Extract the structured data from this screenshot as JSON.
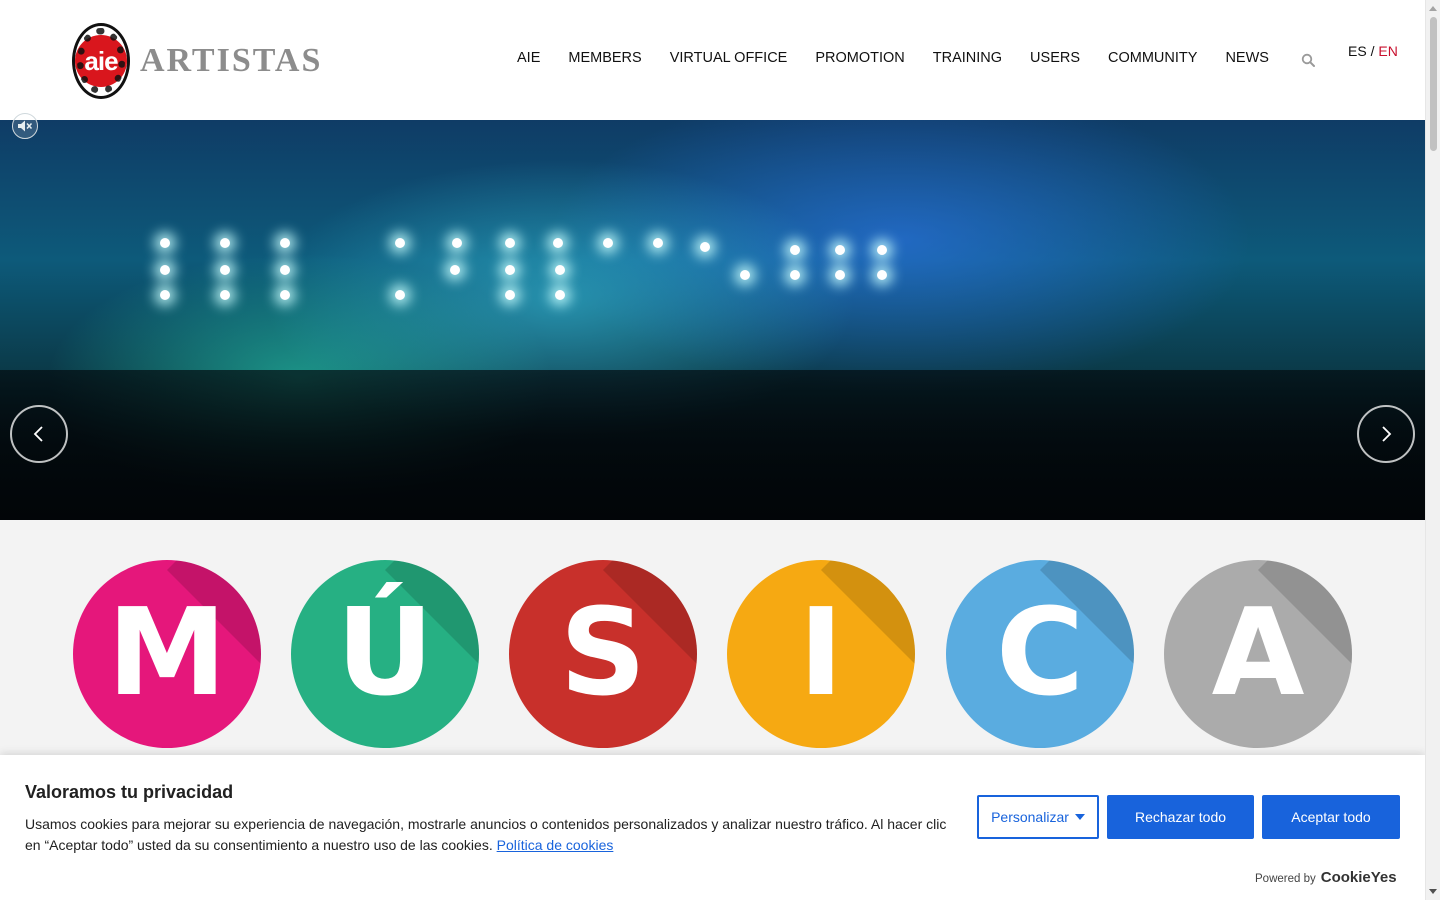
{
  "header": {
    "logo_badge_text": "aie",
    "logo_ring_text": "ARTISTAS · INTÉRPRETES O EJECUTANTES",
    "logo_word": "ARTISTAS",
    "nav": [
      "AIE",
      "MEMBERS",
      "VIRTUAL OFFICE",
      "PROMOTION",
      "TRAINING",
      "USERS",
      "COMMUNITY",
      "NEWS"
    ],
    "search_icon": "search-icon",
    "lang_es": "ES",
    "lang_sep": " / ",
    "lang_en": "EN",
    "active_lang_color": "#c8102e"
  },
  "hero": {
    "mute_icon": "muted-speaker-icon",
    "prev_icon": "chevron-left-icon",
    "next_icon": "chevron-right-icon"
  },
  "musica": {
    "letters": [
      {
        "char": "M",
        "color": "#e5177b"
      },
      {
        "char": "Ú",
        "color": "#26b083"
      },
      {
        "char": "S",
        "color": "#c8302b"
      },
      {
        "char": "I",
        "color": "#f6a912"
      },
      {
        "char": "C",
        "color": "#5aace0"
      },
      {
        "char": "A",
        "color": "#ababab"
      }
    ]
  },
  "cookie": {
    "title": "Valoramos tu privacidad",
    "text": "Usamos cookies para mejorar su experiencia de navegación, mostrarle anuncios o contenidos personalizados y analizar nuestro tráfico. Al hacer clic en “Aceptar todo” usted da su consentimiento a nuestro uso de las cookies. ",
    "policy_link": "Política de cookies",
    "customize_label": "Personalizar",
    "reject_label": "Rechazar todo",
    "accept_label": "Aceptar todo",
    "powered_by": "Powered by",
    "brand": "CookieYes",
    "accent_color": "#1863dc"
  }
}
